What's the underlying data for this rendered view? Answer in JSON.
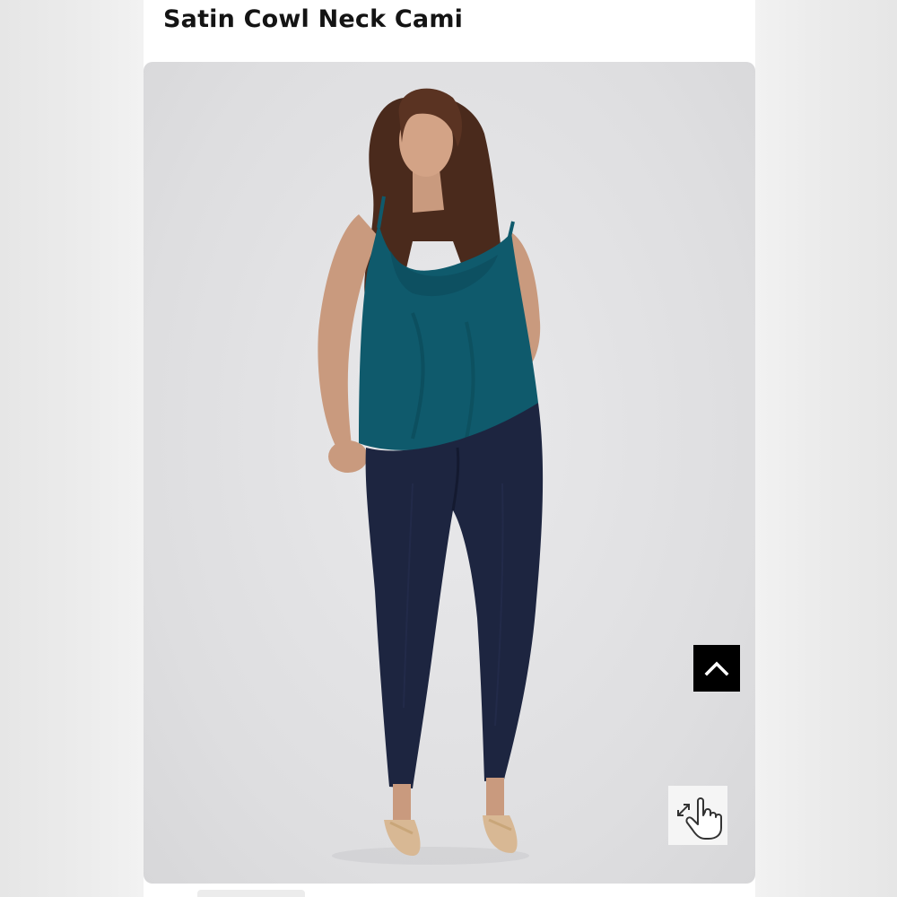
{
  "product": {
    "title": "Satin Cowl Neck Cami"
  },
  "product_image": {
    "alt": "",
    "top_color": "#0f5a6c",
    "jeans_color": "#1d2540",
    "background_color": "#e2e2e4"
  },
  "controls": {
    "scroll_top_icon": "chevron-up-icon",
    "zoom_icon": "hand-pointer-expand-icon"
  }
}
